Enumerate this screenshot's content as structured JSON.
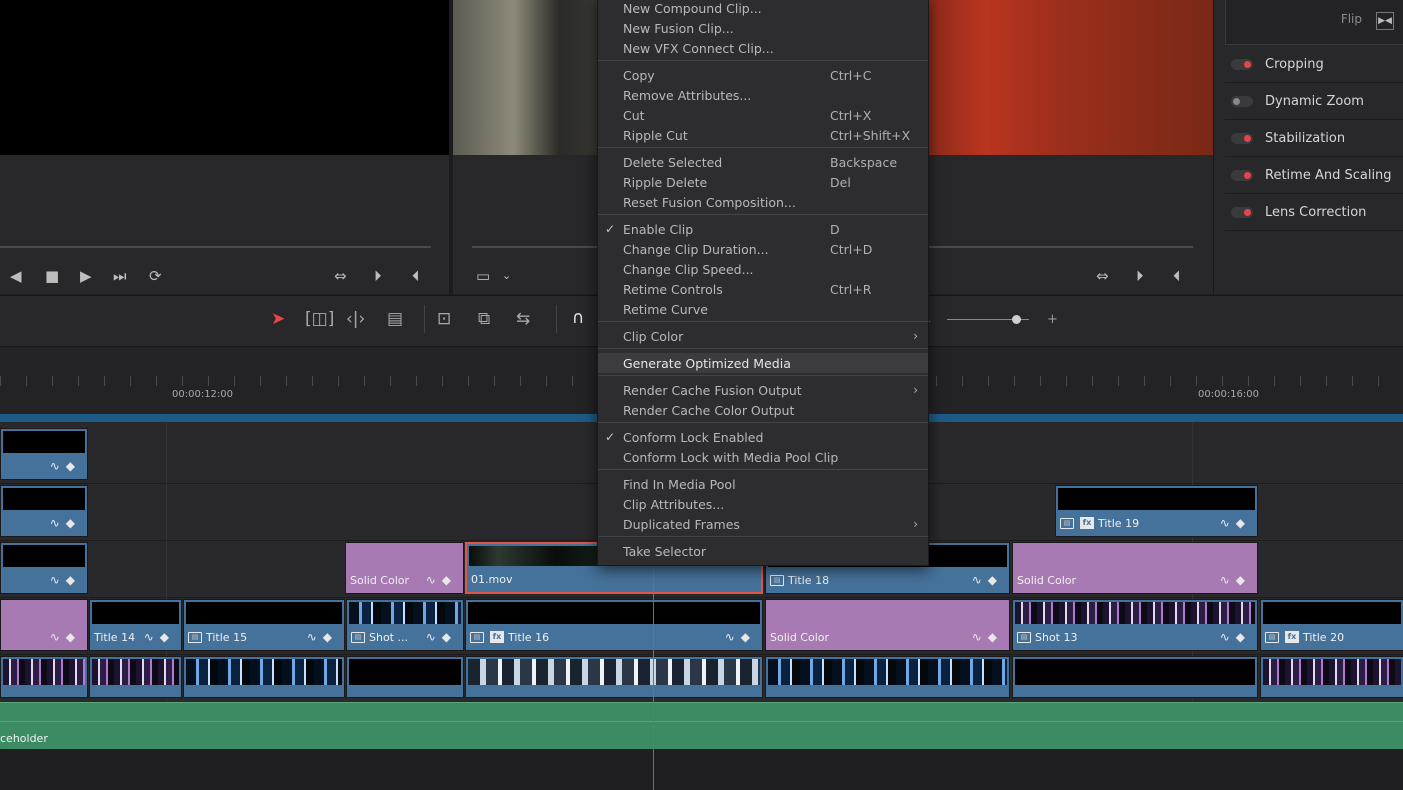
{
  "inspector": {
    "flip_label": "Flip",
    "items": [
      {
        "label": "Cropping",
        "enabled": true
      },
      {
        "label": "Dynamic Zoom",
        "enabled": false
      },
      {
        "label": "Stabilization",
        "enabled": true
      },
      {
        "label": "Retime And Scaling",
        "enabled": true
      },
      {
        "label": "Lens Correction",
        "enabled": true
      }
    ]
  },
  "timeline": {
    "ruler": {
      "tc_left": "00:00:12:00",
      "tc_right": "00:00:16:00"
    },
    "clips": {
      "v4_title19": "Title 19",
      "v3_solid1": "Solid Color",
      "v3_01mov": "01.mov",
      "v3_title18": "Title 18",
      "v3_solid2": "Solid Color",
      "v2_title14": "Title 14",
      "v2_title15": "Title 15",
      "v2_shot": "Shot ...",
      "v2_title16": "Title 16",
      "v2_solid": "Solid Color",
      "v2_shot13": "Shot 13",
      "v2_title20": "Title 20"
    },
    "audio_clip": "ceholder"
  },
  "context_menu": {
    "items": [
      {
        "label": "New Compound Clip...",
        "shortcut": ""
      },
      {
        "label": "New Fusion Clip...",
        "shortcut": ""
      },
      {
        "label": "New VFX Connect Clip...",
        "shortcut": ""
      },
      {
        "label": "Copy",
        "shortcut": "Ctrl+C"
      },
      {
        "label": "Remove Attributes...",
        "shortcut": ""
      },
      {
        "label": "Cut",
        "shortcut": "Ctrl+X"
      },
      {
        "label": "Ripple Cut",
        "shortcut": "Ctrl+Shift+X"
      },
      {
        "label": "Delete Selected",
        "shortcut": "Backspace"
      },
      {
        "label": "Ripple Delete",
        "shortcut": "Del"
      },
      {
        "label": "Reset Fusion Composition...",
        "shortcut": ""
      },
      {
        "label": "Enable Clip",
        "shortcut": "D",
        "checked": true
      },
      {
        "label": "Change Clip Duration...",
        "shortcut": "Ctrl+D"
      },
      {
        "label": "Change Clip Speed...",
        "shortcut": ""
      },
      {
        "label": "Retime Controls",
        "shortcut": "Ctrl+R"
      },
      {
        "label": "Retime Curve",
        "shortcut": ""
      },
      {
        "label": "Clip Color",
        "shortcut": "",
        "submenu": true
      },
      {
        "label": "Generate Optimized Media",
        "shortcut": "",
        "highlighted": true
      },
      {
        "label": "Render Cache Fusion Output",
        "shortcut": "",
        "submenu": true
      },
      {
        "label": "Render Cache Color Output",
        "shortcut": ""
      },
      {
        "label": "Conform Lock Enabled",
        "shortcut": "",
        "checked": true
      },
      {
        "label": "Conform Lock with Media Pool Clip",
        "shortcut": ""
      },
      {
        "label": "Find In Media Pool",
        "shortcut": ""
      },
      {
        "label": "Clip Attributes...",
        "shortcut": ""
      },
      {
        "label": "Duplicated Frames",
        "shortcut": "",
        "submenu": true
      },
      {
        "label": "Take Selector",
        "shortcut": ""
      }
    ]
  },
  "colors": {
    "accent_red": "#e54545",
    "clip_blue": "#45729a",
    "solid_purple": "#a87ab3",
    "audio_green": "#3d8b63",
    "playhead_red": "#d44a3e"
  }
}
